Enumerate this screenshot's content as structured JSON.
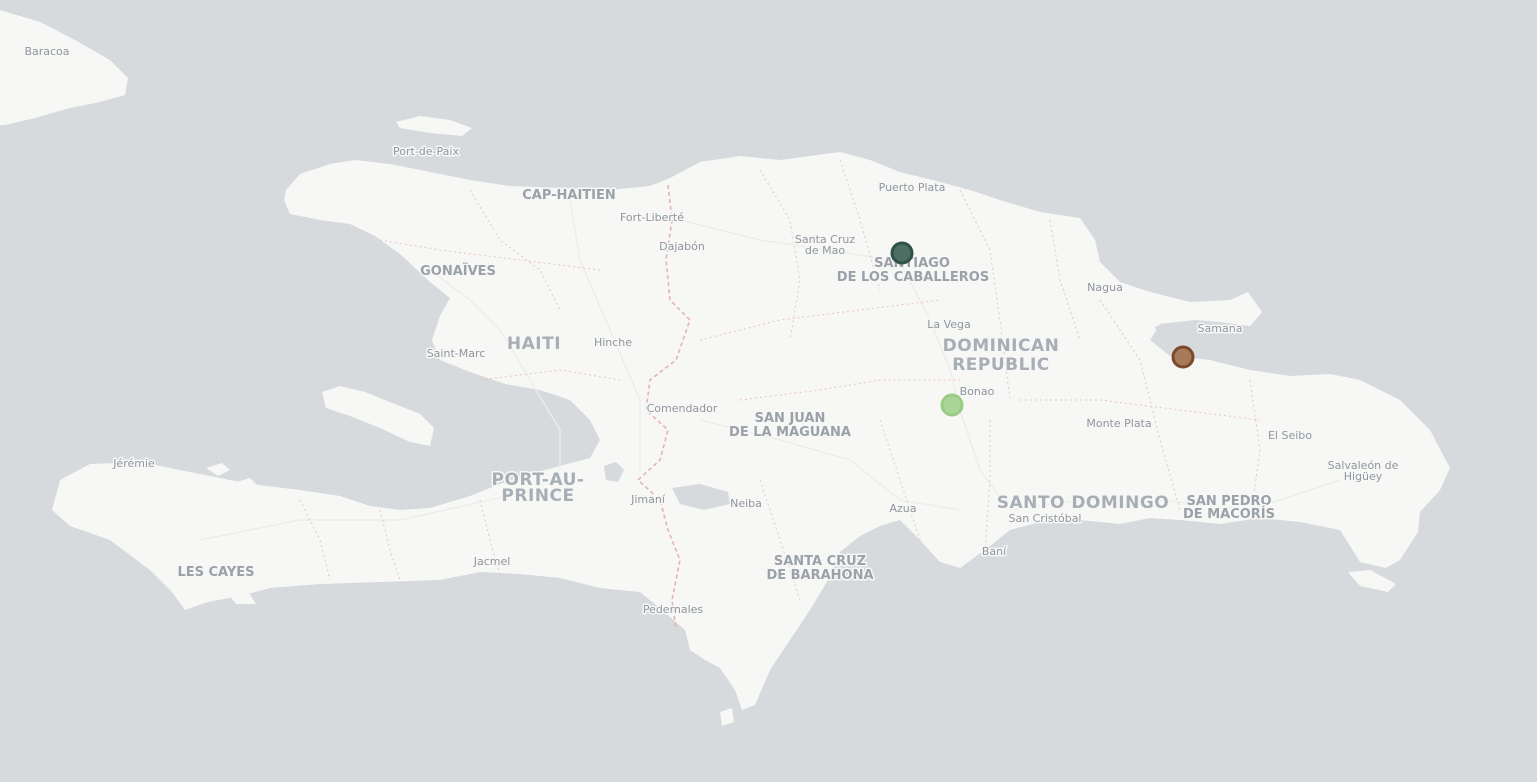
{
  "map": {
    "country_labels": [
      {
        "text": "HAITI"
      },
      {
        "text": "DOMINICAN"
      },
      {
        "text": "REPUBLIC"
      }
    ],
    "city_labels": [
      {
        "text": "Baracoa",
        "size": "sm"
      },
      {
        "text": "Port-de-Paix",
        "size": "sm"
      },
      {
        "text": "CAP-HAITIEN",
        "size": "md"
      },
      {
        "text": "Fort-Liberté",
        "size": "sm"
      },
      {
        "text": "Dajabón",
        "size": "sm"
      },
      {
        "text": "Puerto Plata",
        "size": "sm"
      },
      {
        "text": "Santa Cruz",
        "size": "sm"
      },
      {
        "text": "de Mao",
        "size": "sm"
      },
      {
        "text": "SANTIAGO",
        "size": "md"
      },
      {
        "text": "DE LOS CABALLEROS",
        "size": "md"
      },
      {
        "text": "GONAÏVES",
        "size": "md"
      },
      {
        "text": "Nagua",
        "size": "sm"
      },
      {
        "text": "Samana",
        "size": "sm"
      },
      {
        "text": "La Vega",
        "size": "sm"
      },
      {
        "text": "Hinche",
        "size": "sm"
      },
      {
        "text": "Saint-Marc",
        "size": "sm"
      },
      {
        "text": "Bonao",
        "size": "sm"
      },
      {
        "text": "Comendador",
        "size": "sm"
      },
      {
        "text": "SAN JUAN",
        "size": "md"
      },
      {
        "text": "DE LA MAGUANA",
        "size": "md"
      },
      {
        "text": "Monte Plata",
        "size": "sm"
      },
      {
        "text": "El Seibo",
        "size": "sm"
      },
      {
        "text": "Jérémie",
        "size": "sm"
      },
      {
        "text": "Salvaleón de",
        "size": "sm"
      },
      {
        "text": "Higüey",
        "size": "sm"
      },
      {
        "text": "PORT-AU-",
        "size": "lg"
      },
      {
        "text": "PRINCE",
        "size": "lg"
      },
      {
        "text": "Jimaní",
        "size": "sm"
      },
      {
        "text": "Neiba",
        "size": "sm"
      },
      {
        "text": "Azua",
        "size": "sm"
      },
      {
        "text": "SANTO DOMINGO",
        "size": "lg"
      },
      {
        "text": "San Cristóbal",
        "size": "sm"
      },
      {
        "text": "SAN PEDRO",
        "size": "md"
      },
      {
        "text": "DE MACORÍS",
        "size": "md"
      },
      {
        "text": "Baní",
        "size": "sm"
      },
      {
        "text": "SANTA CRUZ",
        "size": "md"
      },
      {
        "text": "DE BARAHONA",
        "size": "md"
      },
      {
        "text": "Jacmel",
        "size": "sm"
      },
      {
        "text": "LES CAYES",
        "size": "md"
      },
      {
        "text": "Pedernales",
        "size": "sm"
      }
    ],
    "markers": [
      {
        "color": "#2f5246",
        "fill": "#4e6e63"
      },
      {
        "color": "#9bcc85",
        "fill": "#a9d596"
      },
      {
        "color": "#7a4a2a",
        "fill": "#a77a5a"
      }
    ],
    "colors": {
      "water": "#d6dadd",
      "land": "#f7f7f6"
    }
  }
}
